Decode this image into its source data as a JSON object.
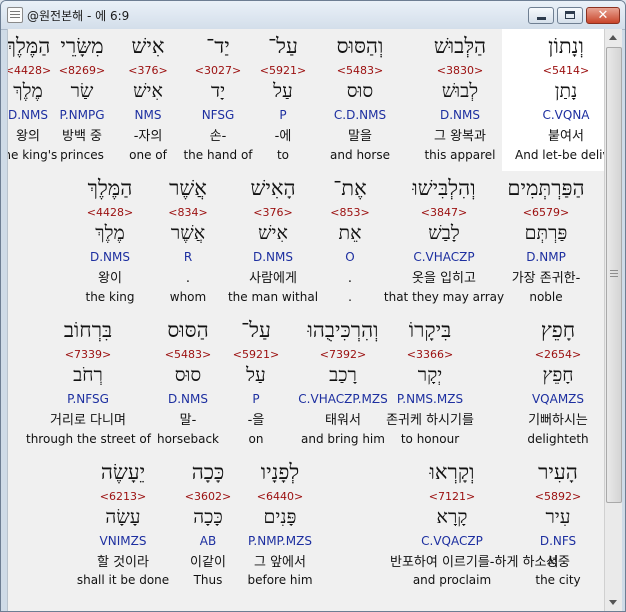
{
  "window": {
    "title": "@원전본해 - 에 6:9"
  },
  "rows": [
    [
      {
        "hebrew": "וְנָתוֹן",
        "strong": "<5414>",
        "lemma": "נָתַן",
        "morph": "C.VQNA",
        "korean": "붙여서",
        "english": "And let-be delive"
      },
      {
        "hebrew": "הַלְּבוּשׁ",
        "strong": "<3830>",
        "lemma": "לְבוּשׁ",
        "morph": "D.NMS",
        "korean": "그 왕복과",
        "english": "this apparel"
      },
      {
        "hebrew": "וְהַסּוּס",
        "strong": "<5483>",
        "lemma": "סוּס",
        "morph": "C.D.NMS",
        "korean": "말을",
        "english": "and horse"
      },
      {
        "hebrew": "עַל־",
        "strong": "<5921>",
        "lemma": "עַל",
        "morph": "P",
        "korean": "-에",
        "english": "to"
      },
      {
        "hebrew": "יַד־",
        "strong": "<3027>",
        "lemma": "יָד",
        "morph": "NFSG",
        "korean": "손-",
        "english": "the hand of"
      },
      {
        "hebrew": "אִישׁ",
        "strong": "<376>",
        "lemma": "אִישׁ",
        "morph": "NMS",
        "korean": "-자의",
        "english": "one of"
      },
      {
        "hebrew": "מִשָּׂרֵי",
        "strong": "<8269>",
        "lemma": "שַׂר",
        "morph": "P.NMPG",
        "korean": "방백 중",
        "english": "princes"
      },
      {
        "hebrew": "הַמֶּלֶךְ",
        "strong": "<4428>",
        "lemma": "מֶלֶךְ",
        "morph": "D.NMS",
        "korean": "왕의",
        "english": "the king's"
      }
    ],
    [
      {
        "hebrew": "הַפַּרְתְּמִים",
        "strong": "<6579>",
        "lemma": "פַּרְתְּם",
        "morph": "D.NMP",
        "korean": "가장 존귀한-",
        "english": "noble"
      },
      {
        "hebrew": "וְהִלְבִּישׁוּ",
        "strong": "<3847>",
        "lemma": "לָבַשׁ",
        "morph": "C.VHACZP",
        "korean": "옷을 입히고",
        "english": "that they may array"
      },
      {
        "hebrew": "אֶת־",
        "strong": "<853>",
        "lemma": "אֵת",
        "morph": "O",
        "korean": ".",
        "english": "."
      },
      {
        "hebrew": "הָאִישׁ",
        "strong": "<376>",
        "lemma": "אִישׁ",
        "morph": "D.NMS",
        "korean": "사람에게",
        "english": "the man withal"
      },
      {
        "hebrew": "אֲשֶׁר",
        "strong": "<834>",
        "lemma": "אֲשֶׁר",
        "morph": "R",
        "korean": ".",
        "english": "whom"
      },
      {
        "hebrew": "הַמֶּלֶךְ",
        "strong": "<4428>",
        "lemma": "מֶלֶךְ",
        "morph": "D.NMS",
        "korean": "왕이",
        "english": "the king"
      }
    ],
    [
      {
        "hebrew": "חָפֵץ",
        "strong": "<2654>",
        "lemma": "חָפֵץ",
        "morph": "VQAMZS",
        "korean": "기뻐하시는",
        "english": "delighteth"
      },
      {
        "hebrew": "בִּיקָרוֹ",
        "strong": "<3366>",
        "lemma": "יְקָר",
        "morph": "P.NMS.MZS",
        "korean": "존귀케 하시기를",
        "english": "to honour"
      },
      {
        "hebrew": "וְהִרְכִּיבֻהוּ",
        "strong": "<7392>",
        "lemma": "רָכַב",
        "morph": "C.VHACZP.MZS",
        "korean": "태워서",
        "english": "and bring him"
      },
      {
        "hebrew": "עַל־",
        "strong": "<5921>",
        "lemma": "עַל",
        "morph": "P",
        "korean": "-을",
        "english": "on"
      },
      {
        "hebrew": "הַסּוּס",
        "strong": "<5483>",
        "lemma": "סוּס",
        "morph": "D.NMS",
        "korean": "말-",
        "english": "horseback"
      },
      {
        "hebrew": "בִּרְחוֹב",
        "strong": "<7339>",
        "lemma": "רְחֹב",
        "morph": "P.NFSG",
        "korean": "거리로 다니며",
        "english": "through the street of"
      }
    ],
    [
      {
        "hebrew": "הָעִיר",
        "strong": "<5892>",
        "lemma": "עִיר",
        "morph": "D.NFS",
        "korean": "성중",
        "english": "the city"
      },
      {
        "hebrew": "וְקָרְאוּ",
        "strong": "<7121>",
        "lemma": "קָרָא",
        "morph": "C.VQACZP",
        "korean": "반포하여 이르기를-하게 하소서",
        "english": "and proclaim"
      },
      {
        "hebrew": "לְפָנָיו",
        "strong": "<6440>",
        "lemma": "פָּנִים",
        "morph": "P.NMP.MZS",
        "korean": "그 앞에서",
        "english": "before him"
      },
      {
        "hebrew": "כָּכָה",
        "strong": "<3602>",
        "lemma": "כָּכָה",
        "morph": "AB",
        "korean": "이같이",
        "english": "Thus"
      },
      {
        "hebrew": "יֵעָשֶׂה",
        "strong": "<6213>",
        "lemma": "עָשָׂה",
        "morph": "VNIMZS",
        "korean": "할 것이라",
        "english": "shall it be done"
      }
    ]
  ]
}
